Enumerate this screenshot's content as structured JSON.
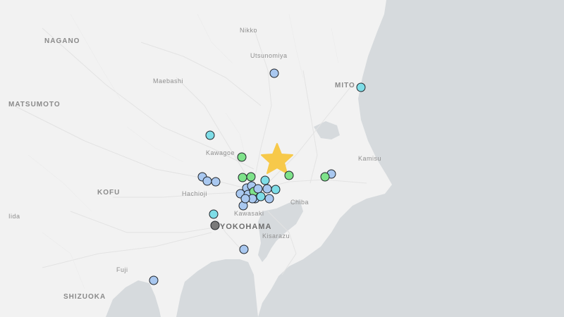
{
  "map": {
    "colors": {
      "water": "#d6dadd",
      "land": "#f2f2f2",
      "road": "#e2e2e2",
      "star": "#f7c94a",
      "intensity_1": "#a9c8f0",
      "intensity_2": "#7edde7",
      "intensity_3": "#7ee28a",
      "intensity_4": "#7a7a7a"
    },
    "labels": [
      {
        "id": "nikko",
        "text": "Nikko",
        "class": "minor"
      },
      {
        "id": "nagano",
        "text": "NAGANO",
        "class": "major"
      },
      {
        "id": "utsunomiya",
        "text": "Utsunomiya",
        "class": "minor"
      },
      {
        "id": "maebashi",
        "text": "Maebashi",
        "class": "minor"
      },
      {
        "id": "mito",
        "text": "MITO",
        "class": "major"
      },
      {
        "id": "matsumoto",
        "text": "MATSUMOTO",
        "class": "major"
      },
      {
        "id": "kawagoe",
        "text": "Kawagoe",
        "class": "minor"
      },
      {
        "id": "kamisu",
        "text": "Kamisu",
        "class": "minor"
      },
      {
        "id": "kofu",
        "text": "KOFU",
        "class": "major"
      },
      {
        "id": "hachioji",
        "text": "Hachioji",
        "class": "minor"
      },
      {
        "id": "chiba",
        "text": "Chiba",
        "class": "minor"
      },
      {
        "id": "iida",
        "text": "Iida",
        "class": "minor"
      },
      {
        "id": "kawasaki",
        "text": "Kawasaki",
        "class": "minor"
      },
      {
        "id": "yokohama",
        "text": "YOKOHAMA",
        "class": "big"
      },
      {
        "id": "kisarazu",
        "text": "Kisarazu",
        "class": "minor"
      },
      {
        "id": "fuji",
        "text": "Fuji",
        "class": "minor"
      },
      {
        "id": "shizuoka",
        "text": "SHIZUOKA",
        "class": "major"
      }
    ],
    "epicenter": {
      "icon": "star-icon"
    },
    "markers": [
      {
        "intensity": "intensity_1"
      },
      {
        "intensity": "intensity_2"
      },
      {
        "intensity": "intensity_2"
      },
      {
        "intensity": "intensity_3"
      },
      {
        "intensity": "intensity_1"
      },
      {
        "intensity": "intensity_1"
      },
      {
        "intensity": "intensity_1"
      },
      {
        "intensity": "intensity_3"
      },
      {
        "intensity": "intensity_3"
      },
      {
        "intensity": "intensity_2"
      },
      {
        "intensity": "intensity_3"
      },
      {
        "intensity": "intensity_1"
      },
      {
        "intensity": "intensity_3"
      },
      {
        "intensity": "intensity_1"
      },
      {
        "intensity": "intensity_1"
      },
      {
        "intensity": "intensity_1"
      },
      {
        "intensity": "intensity_1"
      },
      {
        "intensity": "intensity_1"
      },
      {
        "intensity": "intensity_3"
      },
      {
        "intensity": "intensity_1"
      },
      {
        "intensity": "intensity_2"
      },
      {
        "intensity": "intensity_2"
      },
      {
        "intensity": "intensity_1"
      },
      {
        "intensity": "intensity_1"
      },
      {
        "intensity": "intensity_1"
      },
      {
        "intensity": "intensity_1"
      },
      {
        "intensity": "intensity_1"
      },
      {
        "intensity": "intensity_2"
      },
      {
        "intensity": "intensity_4"
      },
      {
        "intensity": "intensity_1"
      },
      {
        "intensity": "intensity_1"
      }
    ]
  }
}
